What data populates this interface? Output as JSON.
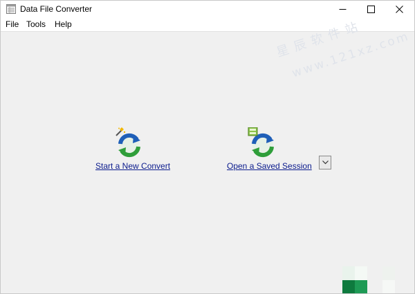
{
  "window": {
    "title": "Data File Converter"
  },
  "menu": {
    "items": [
      "File",
      "Tools",
      "Help"
    ]
  },
  "watermark": {
    "line1": "星辰软件站",
    "line2": "www.121xz.com"
  },
  "actions": {
    "new_convert_label": "Start a New Convert",
    "open_session_label": "Open a Saved Session"
  },
  "colors": {
    "link": "#0a1a8c",
    "background": "#f0f0f0",
    "icon_green": "#2f9e3a",
    "icon_blue": "#1f5fb8"
  },
  "icons": {
    "app": "app-icon",
    "minimize": "minimize-icon",
    "maximize": "maximize-icon",
    "close": "close-icon",
    "new_convert": "convert-arrows-wand-icon",
    "open_session": "convert-arrows-document-icon",
    "dropdown": "chevron-down-icon"
  }
}
